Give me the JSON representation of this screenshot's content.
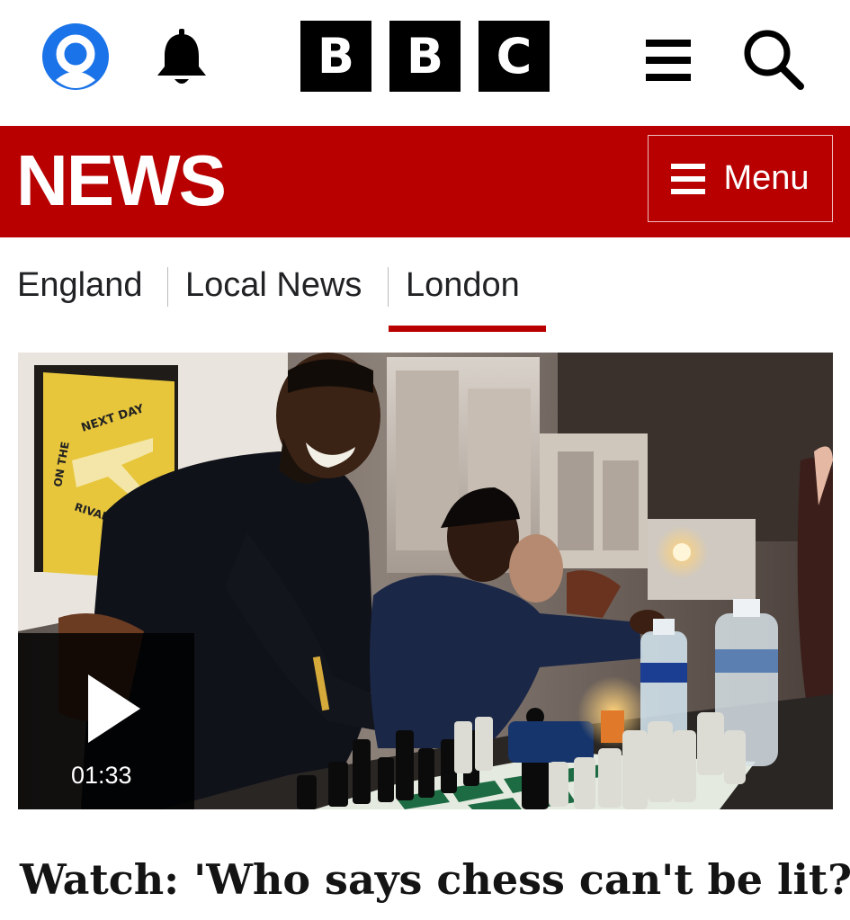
{
  "header": {
    "account_icon": "account-icon",
    "notifications_icon": "bell-icon",
    "logo_letters": [
      "B",
      "B",
      "C"
    ],
    "menu_icon": "hamburger-icon",
    "search_icon": "search-icon"
  },
  "news_bar": {
    "title": "NEWS",
    "menu_label": "Menu",
    "menu_icon": "hamburger-icon",
    "color": "#b80000"
  },
  "nav": {
    "items": [
      {
        "label": "England",
        "active": false
      },
      {
        "label": "Local News",
        "active": false
      },
      {
        "label": "London",
        "active": true
      }
    ]
  },
  "media": {
    "play_icon": "play-icon",
    "duration": "01:33",
    "poster_text_top": "NEXT DAY",
    "poster_text_side": "ON THE",
    "poster_text_bottom": "RIVALS ON"
  },
  "article": {
    "headline": "Watch: 'Who says chess can't be lit?'"
  }
}
